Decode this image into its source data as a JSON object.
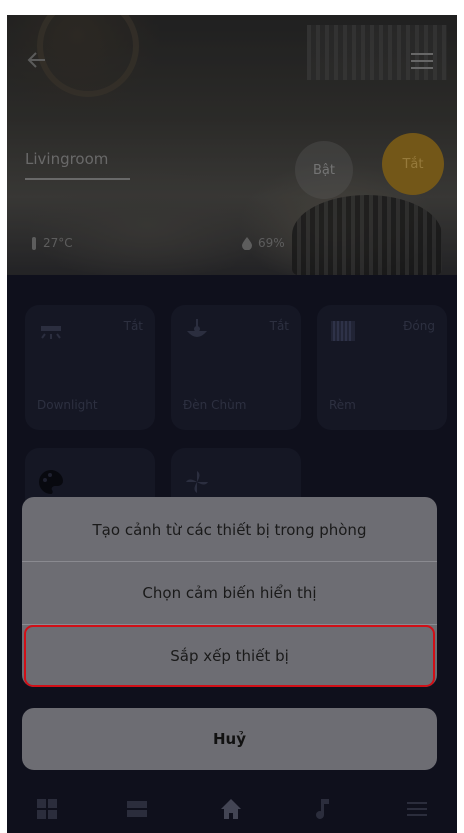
{
  "room": {
    "name": "Livingroom",
    "on_label": "Bật",
    "off_label": "Tắt",
    "temperature": "27°C",
    "humidity": "69%"
  },
  "devices": [
    {
      "name": "Downlight",
      "state": "Tắt",
      "icon": "downlight-icon"
    },
    {
      "name": "Đèn Chùm",
      "state": "Tắt",
      "icon": "chandelier-icon"
    },
    {
      "name": "Rèm",
      "state": "Đóng",
      "icon": "curtain-icon"
    },
    {
      "name": "",
      "state": "",
      "icon": "palette-icon"
    },
    {
      "name": "",
      "state": "",
      "icon": "fan-icon"
    }
  ],
  "sheet": {
    "items": [
      "Tạo cảnh từ các thiết bị trong phòng",
      "Chọn cảm biến hiển thị",
      "Sắp xếp thiết bị"
    ],
    "cancel": "Huỷ"
  },
  "nav": [
    "grid-icon",
    "list-icon",
    "home-icon",
    "music-icon",
    "menu-icon"
  ],
  "colors": {
    "background": "#141626",
    "card": "#1c1f31",
    "accent_off": "#9a7421",
    "sheet": "#6d6d73",
    "highlight": "#d10f17"
  }
}
